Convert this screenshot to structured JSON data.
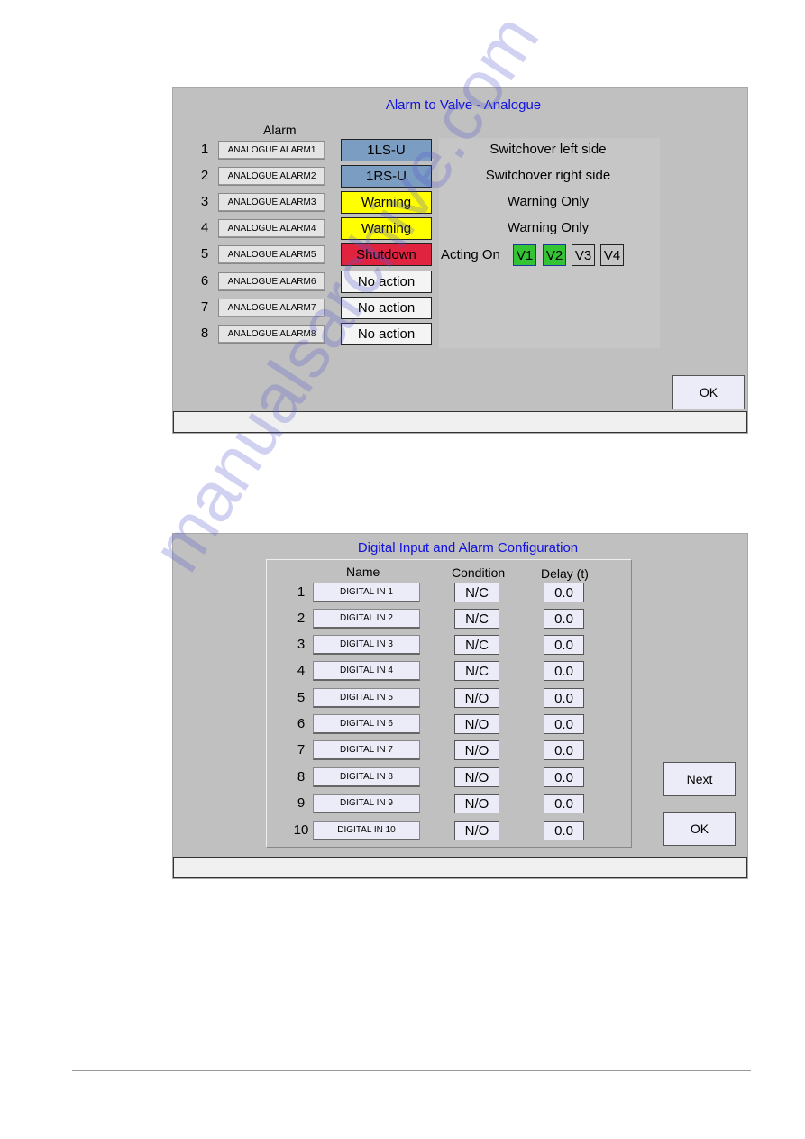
{
  "watermark": "manualsarchive.com",
  "analogue": {
    "title": "Alarm to Valve - Analogue",
    "alarm_header": "Alarm",
    "rows": [
      {
        "num": "1",
        "alarm": "ANALOGUE ALARM1",
        "action": "1LS-U",
        "desc": "Switchover left side"
      },
      {
        "num": "2",
        "alarm": "ANALOGUE ALARM2",
        "action": "1RS-U",
        "desc": "Switchover right side"
      },
      {
        "num": "3",
        "alarm": "ANALOGUE ALARM3",
        "action": "Warning",
        "desc": "Warning Only"
      },
      {
        "num": "4",
        "alarm": "ANALOGUE ALARM4",
        "action": "Warning",
        "desc": "Warning Only"
      },
      {
        "num": "5",
        "alarm": "ANALOGUE ALARM5",
        "action": "Shutdown",
        "desc": ""
      },
      {
        "num": "6",
        "alarm": "ANALOGUE ALARM6",
        "action": "No action",
        "desc": ""
      },
      {
        "num": "7",
        "alarm": "ANALOGUE ALARM7",
        "action": "No action",
        "desc": ""
      },
      {
        "num": "8",
        "alarm": "ANALOGUE ALARM8",
        "action": "No action",
        "desc": ""
      }
    ],
    "acting_on": "Acting On",
    "valves": [
      {
        "label": "V1",
        "active": true
      },
      {
        "label": "V2",
        "active": true
      },
      {
        "label": "V3",
        "active": false
      },
      {
        "label": "V4",
        "active": false
      }
    ],
    "ok": "OK",
    "colors": {
      "switchover": "#7b9dc2",
      "warning": "#ffff00",
      "shutdown": "#e0233f",
      "none": "#f4f4f4",
      "valve_active": "#33c433",
      "title": "#1010e0"
    }
  },
  "digital": {
    "title": "Digital Input and Alarm Configuration",
    "headers": {
      "name": "Name",
      "condition": "Condition",
      "delay": "Delay (t)"
    },
    "rows": [
      {
        "num": "1",
        "name": "DIGITAL IN 1",
        "condition": "N/C",
        "delay": "0.0"
      },
      {
        "num": "2",
        "name": "DIGITAL IN 2",
        "condition": "N/C",
        "delay": "0.0"
      },
      {
        "num": "3",
        "name": "DIGITAL IN 3",
        "condition": "N/C",
        "delay": "0.0"
      },
      {
        "num": "4",
        "name": "DIGITAL IN 4",
        "condition": "N/C",
        "delay": "0.0"
      },
      {
        "num": "5",
        "name": "DIGITAL IN 5",
        "condition": "N/O",
        "delay": "0.0"
      },
      {
        "num": "6",
        "name": "DIGITAL IN 6",
        "condition": "N/O",
        "delay": "0.0"
      },
      {
        "num": "7",
        "name": "DIGITAL IN 7",
        "condition": "N/O",
        "delay": "0.0"
      },
      {
        "num": "8",
        "name": "DIGITAL IN 8",
        "condition": "N/O",
        "delay": "0.0"
      },
      {
        "num": "9",
        "name": "DIGITAL IN 9",
        "condition": "N/O",
        "delay": "0.0"
      },
      {
        "num": "10",
        "name": "DIGITAL IN 10",
        "condition": "N/O",
        "delay": "0.0"
      }
    ],
    "next": "Next",
    "ok": "OK"
  }
}
